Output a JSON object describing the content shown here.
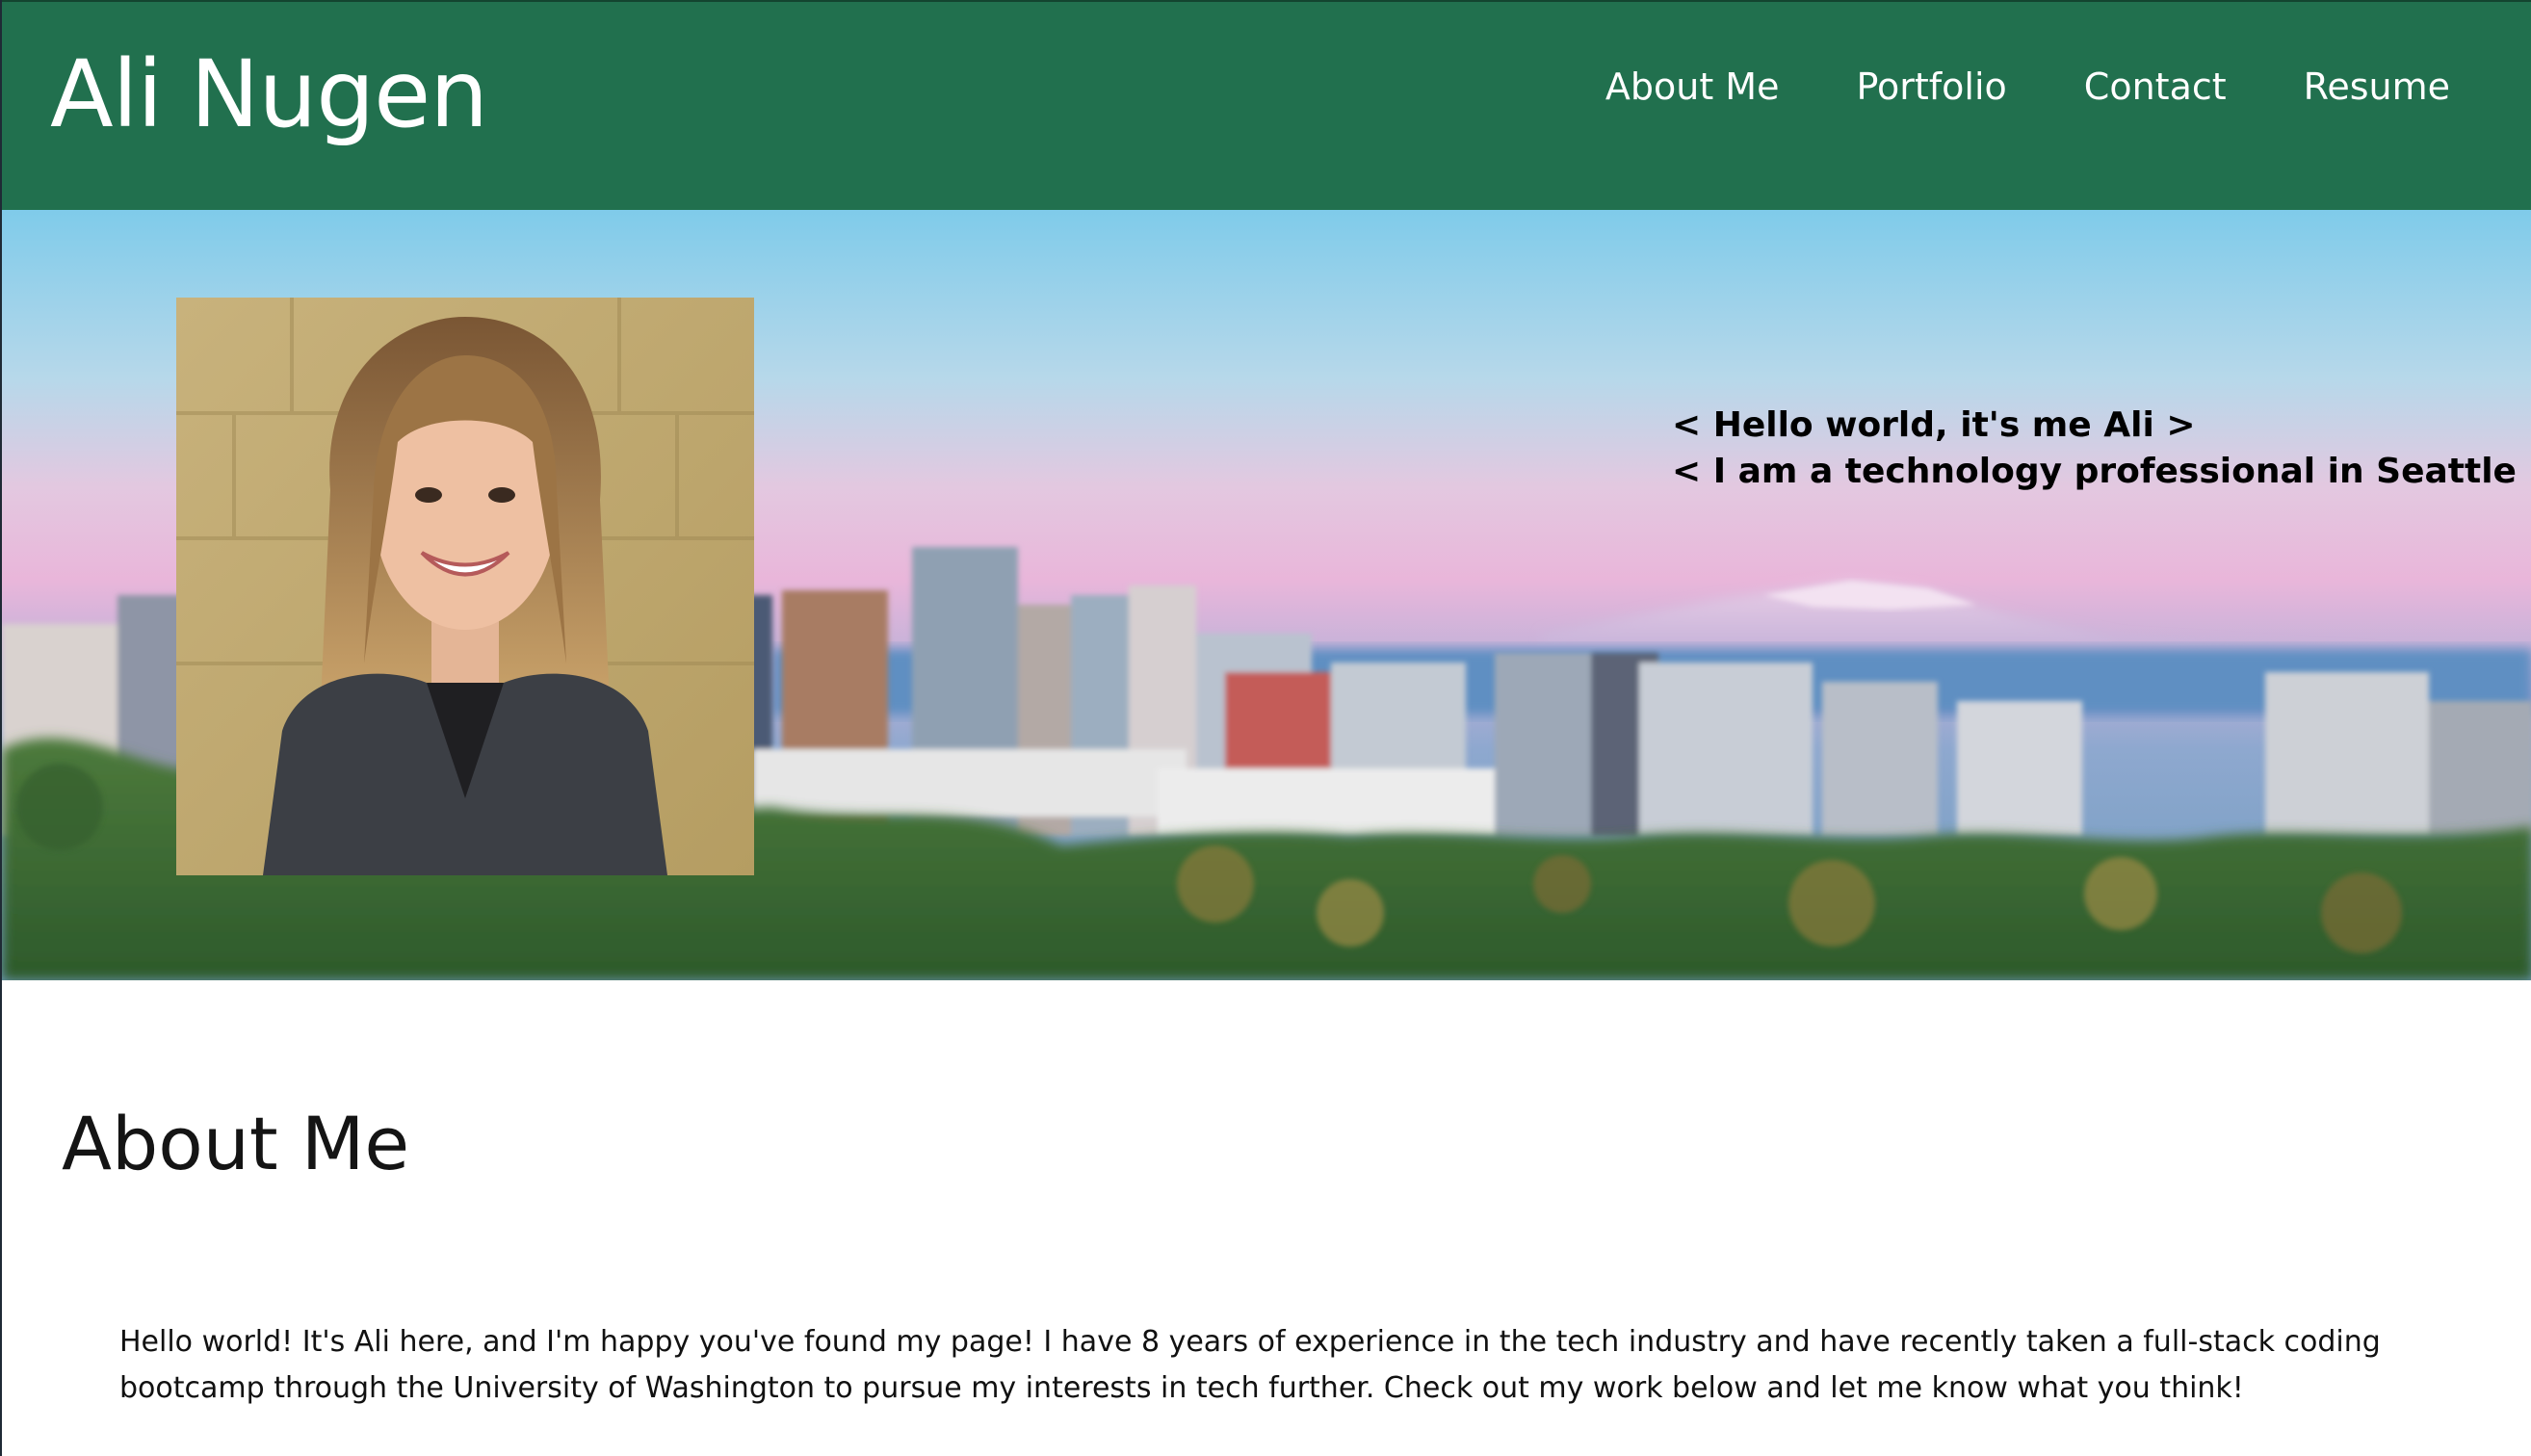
{
  "header": {
    "title": "Ali Nugen",
    "nav": {
      "about": "About Me",
      "portfolio": "Portfolio",
      "contact": "Contact",
      "resume": "Resume"
    }
  },
  "hero": {
    "line1": "< Hello world, it's me Ali >",
    "line2": "< I am a technology professional in Seattle >"
  },
  "about": {
    "heading": "About Me",
    "paragraph": "Hello world! It's Ali here, and I'm happy you've found my page! I have 8 years of experience in the tech industry and have recently taken a full-stack coding bootcamp through the University of Washington to pursue my interests in tech further. Check out my work below and let me know what you think!"
  },
  "colors": {
    "header_bg": "#21704e",
    "header_text": "#ffffff",
    "body_text": "#111111"
  }
}
